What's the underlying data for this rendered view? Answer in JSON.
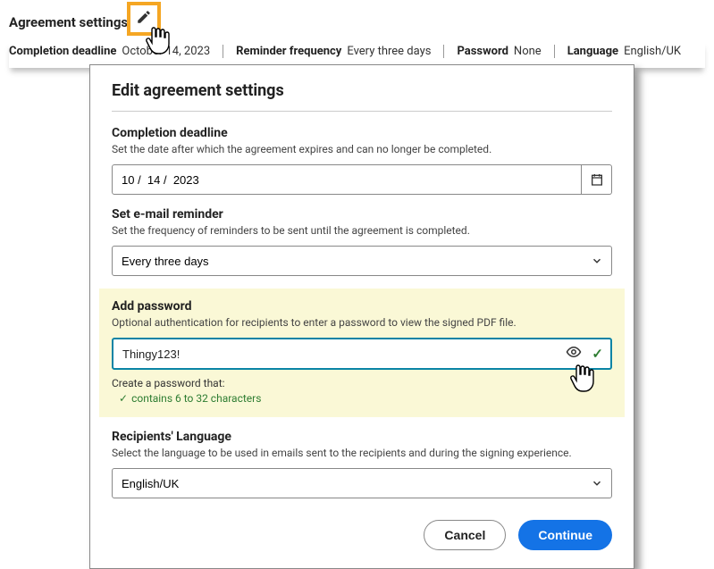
{
  "header": {
    "title": "Agreement settings",
    "meta": {
      "completion_label": "Completion deadline",
      "completion_value": "October 14, 2023",
      "reminder_label": "Reminder frequency",
      "reminder_value": "Every three days",
      "password_label": "Password",
      "password_value": "None",
      "language_label": "Language",
      "language_value": "English/UK"
    }
  },
  "dialog": {
    "title": "Edit agreement settings",
    "completion": {
      "title": "Completion deadline",
      "desc": "Set the date after which the agreement expires and can no longer be completed.",
      "value": "10 /  14 /  2023"
    },
    "reminder": {
      "title": "Set e-mail reminder",
      "desc": "Set the frequency of reminders to be sent until the agreement is completed.",
      "value": "Every three days"
    },
    "password": {
      "title": "Add password",
      "desc": "Optional authentication for recipients to enter a password to view the signed PDF file.",
      "value": "Thingy123!",
      "hint": "Create a password that:",
      "rule": "contains 6 to 32 characters"
    },
    "language": {
      "title": "Recipients' Language",
      "desc": "Select the language to be used in emails sent to the recipients and during the signing experience.",
      "value": "English/UK"
    },
    "buttons": {
      "cancel": "Cancel",
      "continue": "Continue"
    }
  }
}
